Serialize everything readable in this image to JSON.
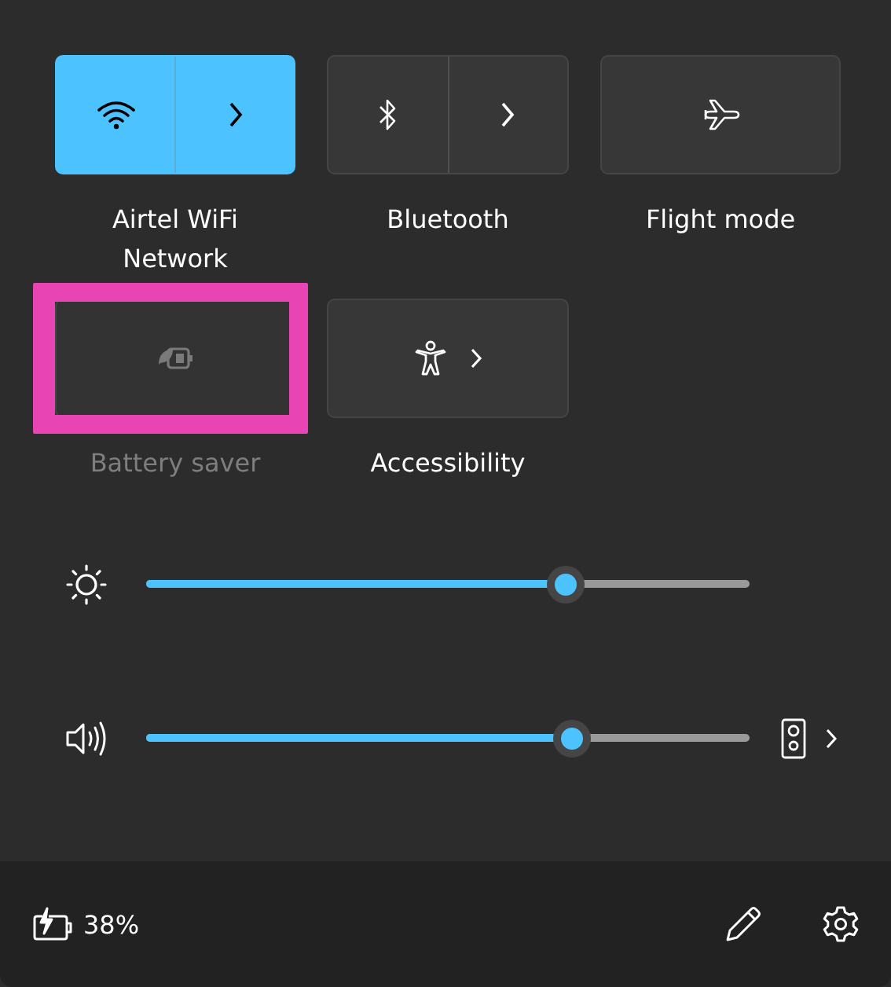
{
  "tiles": [
    {
      "kind": "wifi",
      "label": "Airtel WiFi Network",
      "on": true,
      "disabled": false,
      "highlighted": false
    },
    {
      "kind": "bluetooth",
      "label": "Bluetooth",
      "on": false,
      "disabled": false,
      "highlighted": false
    },
    {
      "kind": "flight",
      "label": "Flight mode",
      "on": false,
      "disabled": false,
      "highlighted": false
    },
    {
      "kind": "battery",
      "label": "Battery saver",
      "on": false,
      "disabled": true,
      "highlighted": true
    },
    {
      "kind": "accessibility",
      "label": "Accessibility",
      "on": false,
      "disabled": false,
      "highlighted": false
    }
  ],
  "sliders": [
    {
      "kind": "brightness",
      "level": 0.695
    },
    {
      "kind": "volume",
      "level": 0.705
    }
  ],
  "footer": {
    "battery": "38%"
  }
}
